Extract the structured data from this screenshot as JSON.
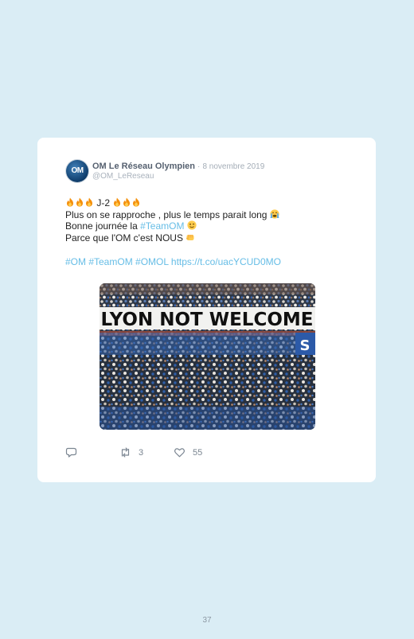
{
  "tweet": {
    "author_name": "OM Le Réseau Olympien",
    "separator": "·",
    "date": "8 novembre 2019",
    "handle": "@OM_LeReseau",
    "avatar_text": "OM",
    "lines": {
      "l1_text": "J-2",
      "l2_text": "Plus on se rapproche , plus le temps parait long",
      "l3_text": "Bonne journée la",
      "l3_link": "#TeamOM",
      "l4_text": "Parce que l'OM c'est NOUS",
      "l5_links": "#OM #TeamOM #OMOL https://t.co/uacYCUD0MO"
    },
    "emojis": [
      "fire-emoji",
      "fire-emoji",
      "fire-emoji",
      "fire-emoji",
      "fire-emoji",
      "fire-emoji",
      "crying-face-emoji",
      "winking-face-emoji",
      "fist-emoji"
    ],
    "media": {
      "banner_text": "LYON NOT WELCOME"
    },
    "actions": {
      "reply_icon": "reply-icon",
      "retweet_icon": "retweet-icon",
      "retweet_count": "3",
      "like_icon": "heart-icon",
      "like_count": "55"
    }
  },
  "page": {
    "number": "37"
  },
  "colors": {
    "background": "#daedf5",
    "card": "#ffffff",
    "link": "#66bde6",
    "name": "#566170",
    "muted": "#a4adb7"
  }
}
